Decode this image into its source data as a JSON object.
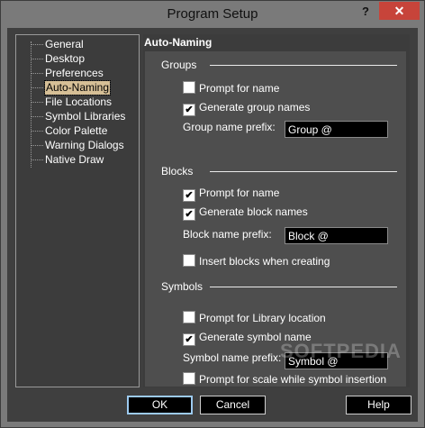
{
  "window": {
    "title": "Program Setup",
    "help_label": "?",
    "close_label": "✕"
  },
  "tree": {
    "items": [
      {
        "label": "General"
      },
      {
        "label": "Desktop"
      },
      {
        "label": "Preferences"
      },
      {
        "label": "Auto-Naming",
        "selected": true
      },
      {
        "label": "File Locations"
      },
      {
        "label": "Symbol Libraries"
      },
      {
        "label": "Color Palette"
      },
      {
        "label": "Warning Dialogs"
      },
      {
        "label": "Native Draw"
      }
    ]
  },
  "panel": {
    "title": "Auto-Naming",
    "groups": {
      "label": "Groups",
      "prompt_for_name": {
        "label": "Prompt for name",
        "checked": false
      },
      "generate_names": {
        "label": "Generate group names",
        "checked": true
      },
      "prefix_label": "Group name prefix:",
      "prefix_value": "Group @"
    },
    "blocks": {
      "label": "Blocks",
      "prompt_for_name": {
        "label": "Prompt for name",
        "checked": true
      },
      "generate_names": {
        "label": "Generate block names",
        "checked": true
      },
      "prefix_label": "Block name prefix:",
      "prefix_value": "Block @",
      "insert_when_creating": {
        "label": "Insert blocks when creating",
        "checked": false
      }
    },
    "symbols": {
      "label": "Symbols",
      "prompt_library": {
        "label": "Prompt for Library location",
        "checked": false
      },
      "generate_names": {
        "label": "Generate symbol name",
        "checked": true
      },
      "prefix_label": "Symbol name prefix:",
      "prefix_value": "Symbol @",
      "prompt_scale": {
        "label": "Prompt for scale while symbol insertion",
        "checked": false
      }
    }
  },
  "buttons": {
    "ok": "OK",
    "cancel": "Cancel",
    "help": "Help"
  },
  "watermark": "SOFTPEDIA"
}
